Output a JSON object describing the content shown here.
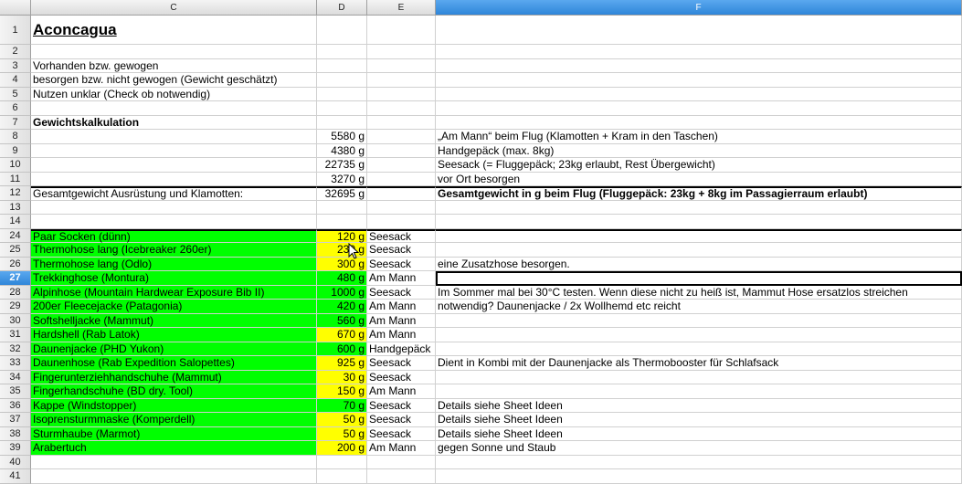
{
  "columns": [
    "C",
    "D",
    "E",
    "F"
  ],
  "rows": [
    {
      "num": "1",
      "C": "Aconcagua",
      "D": "",
      "E": "",
      "F": "",
      "style": "title"
    },
    {
      "num": "2",
      "C": "",
      "D": "",
      "E": "",
      "F": ""
    },
    {
      "num": "3",
      "C": "Vorhanden bzw. gewogen",
      "D": "",
      "E": "",
      "F": ""
    },
    {
      "num": "4",
      "C": "besorgen bzw. nicht gewogen (Gewicht geschätzt)",
      "D": "",
      "E": "",
      "F": ""
    },
    {
      "num": "5",
      "C": "Nutzen unklar (Check ob notwendig)",
      "D": "",
      "E": "",
      "F": ""
    },
    {
      "num": "6",
      "C": "",
      "D": "",
      "E": "",
      "F": ""
    },
    {
      "num": "7",
      "C": "Gewichtskalkulation",
      "D": "",
      "E": "",
      "F": "",
      "style": "boldC"
    },
    {
      "num": "8",
      "C": "",
      "D": "5580 g",
      "E": "",
      "F": "„Am Mann“ beim Flug (Klamotten + Kram in den Taschen)"
    },
    {
      "num": "9",
      "C": "",
      "D": "4380 g",
      "E": "",
      "F": "Handgepäck (max. 8kg)"
    },
    {
      "num": "10",
      "C": "",
      "D": "22735 g",
      "E": "",
      "F": "Seesack (= Fluggepäck; 23kg erlaubt, Rest Übergewicht)"
    },
    {
      "num": "11",
      "C": "",
      "D": "3270 g",
      "E": "",
      "F": "vor Ort besorgen"
    },
    {
      "num": "12",
      "C": "Gesamtgewicht Ausrüstung und Klamotten:",
      "D": "32695 g",
      "E": "",
      "F": "Gesamtgewicht in g beim Flug (Fluggepäck: 23kg + 8kg im Passagierraum erlaubt)",
      "style": "boldF"
    },
    {
      "num": "13",
      "C": "",
      "D": "",
      "E": "",
      "F": ""
    },
    {
      "num": "14",
      "C": "",
      "D": "",
      "E": "",
      "F": ""
    },
    {
      "num": "24",
      "C": "Paar Socken (dünn)",
      "D": "120 g",
      "E": "Seesack",
      "F": "",
      "cC": "green",
      "cD": "yellow"
    },
    {
      "num": "25",
      "C": "Thermohose lang (Icebreaker 260er)",
      "D": "230 g",
      "E": "Seesack",
      "F": "",
      "cC": "green",
      "cD": "yellow"
    },
    {
      "num": "26",
      "C": "Thermohose lang (Odlo)",
      "D": "300 g",
      "E": "Seesack",
      "F": "eine Zusatzhose besorgen.",
      "cC": "green",
      "cD": "yellow"
    },
    {
      "num": "27",
      "C": "Trekkinghose (Montura)",
      "D": "480 g",
      "E": "Am Mann",
      "F": "",
      "cC": "green",
      "cD": "green",
      "sel": true
    },
    {
      "num": "28",
      "C": "Alpinhose (Mountain Hardwear Exposure Bib II)",
      "D": "1000 g",
      "E": "Seesack",
      "F": "Im Sommer mal bei 30°C testen. Wenn diese nicht zu heiß ist, Mammut Hose ersatzlos streichen",
      "cC": "green",
      "cD": "green"
    },
    {
      "num": "29",
      "C": "200er Fleecejacke (Patagonia)",
      "D": "420 g",
      "E": "Am Mann",
      "F": "notwendig? Daunenjacke / 2x Wollhemd etc reicht",
      "cC": "green",
      "cD": "green"
    },
    {
      "num": "30",
      "C": "Softshelljacke (Mammut)",
      "D": "560 g",
      "E": "Am Mann",
      "F": "",
      "cC": "green",
      "cD": "green"
    },
    {
      "num": "31",
      "C": "Hardshell (Rab Latok)",
      "D": "670 g",
      "E": "Am Mann",
      "F": "",
      "cC": "green",
      "cD": "yellow"
    },
    {
      "num": "32",
      "C": "Daunenjacke (PHD Yukon)",
      "D": "600 g",
      "E": "Handgepäck",
      "F": "",
      "cC": "green",
      "cD": "green"
    },
    {
      "num": "33",
      "C": "Daunenhose (Rab Expedition Salopettes)",
      "D": "925 g",
      "E": "Seesack",
      "F": "Dient in Kombi mit der Daunenjacke als Thermobooster für Schlafsack",
      "cC": "green",
      "cD": "yellow"
    },
    {
      "num": "34",
      "C": "Fingerunterziehhandschuhe (Mammut)",
      "D": "30 g",
      "E": "Seesack",
      "F": "",
      "cC": "green",
      "cD": "yellow"
    },
    {
      "num": "35",
      "C": "Fingerhandschuhe (BD dry. Tool)",
      "D": "150 g",
      "E": "Am Mann",
      "F": "",
      "cC": "green",
      "cD": "yellow"
    },
    {
      "num": "36",
      "C": "Kappe (Windstopper)",
      "D": "70 g",
      "E": "Seesack",
      "F": "Details siehe Sheet Ideen",
      "cC": "green",
      "cD": "green"
    },
    {
      "num": "37",
      "C": "Isoprensturmmaske (Komperdell)",
      "D": "50 g",
      "E": "Seesack",
      "F": "Details siehe Sheet Ideen",
      "cC": "green",
      "cD": "yellow"
    },
    {
      "num": "38",
      "C": "Sturmhaube (Marmot)",
      "D": "50 g",
      "E": "Seesack",
      "F": "Details siehe Sheet Ideen",
      "cC": "green",
      "cD": "yellow"
    },
    {
      "num": "39",
      "C": "Arabertuch",
      "D": "200 g",
      "E": "Am Mann",
      "F": "gegen Sonne und Staub",
      "cC": "green",
      "cD": "yellow"
    },
    {
      "num": "40",
      "C": "",
      "D": "",
      "E": "",
      "F": ""
    },
    {
      "num": "41",
      "C": "",
      "D": "",
      "E": "",
      "F": ""
    }
  ],
  "colors": {
    "green": "#00ff00",
    "yellow": "#ffff00",
    "selection": "#2f86d9"
  }
}
